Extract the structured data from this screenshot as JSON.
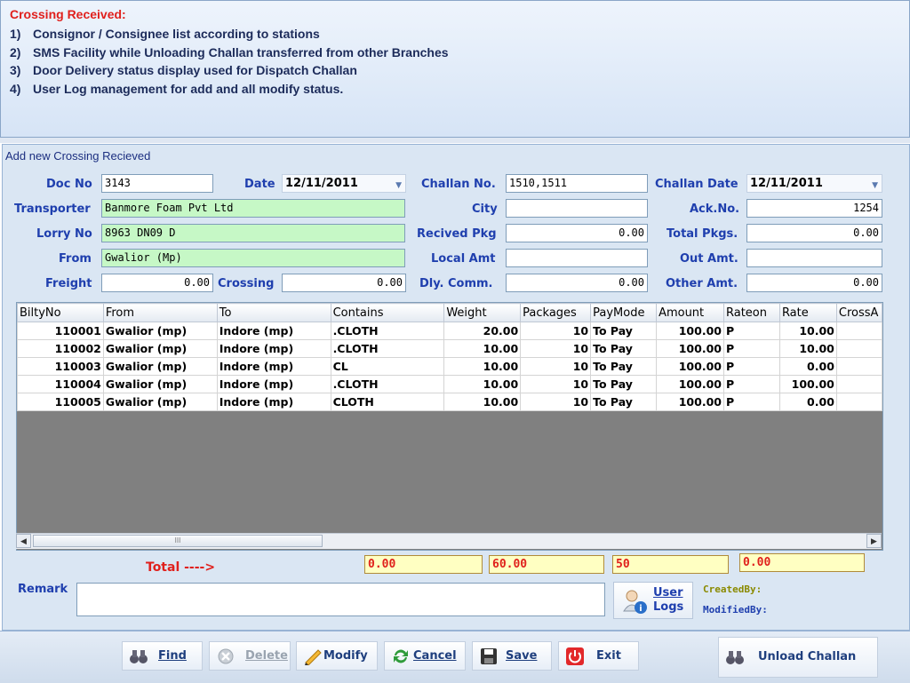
{
  "notes": {
    "title": "Crossing Received:",
    "items": [
      {
        "n": "1)",
        "text": "Consignor / Consignee list according to stations"
      },
      {
        "n": "2)",
        "text": "SMS Facility while Unloading Challan transferred from other Branches"
      },
      {
        "n": "3)",
        "text": "Door Delivery status display used for Dispatch Challan"
      },
      {
        "n": "4)",
        "text": "User Log management for add and all modify status."
      }
    ]
  },
  "form": {
    "title": "Add new Crossing Recieved",
    "labels": {
      "doc_no": "Doc No",
      "date": "Date",
      "challan_no": "Challan No.",
      "challan_date": "Challan Date",
      "transporter": "Transporter",
      "city": "City",
      "ack_no": "Ack.No.",
      "lorry_no": "Lorry No",
      "recived_pkg": "Recived Pkg",
      "total_pkgs": "Total Pkgs.",
      "from": "From",
      "local_amt": "Local Amt",
      "out_amt": "Out Amt.",
      "freight": "Freight",
      "crossing": "Crossing",
      "dly_comm": "Dly. Comm.",
      "other_amt": "Other Amt."
    },
    "values": {
      "doc_no": "3143",
      "date": "12/11/2011",
      "challan_no": "1510,1511",
      "challan_date": "12/11/2011",
      "transporter": "Banmore Foam Pvt Ltd",
      "city": "",
      "ack_no": "1254",
      "lorry_no": "8963 DN09 D",
      "recived_pkg": "0.00",
      "total_pkgs": "0.00",
      "from": "Gwalior (Mp)",
      "local_amt": "",
      "out_amt": "",
      "freight": "0.00",
      "crossing": "0.00",
      "dly_comm": "0.00",
      "other_amt": "0.00"
    }
  },
  "grid": {
    "columns": [
      "BiltyNo",
      "From",
      "To",
      "Contains",
      "Weight",
      "Packages",
      "PayMode",
      "Amount",
      "Rateon",
      "Rate",
      "CrossA"
    ],
    "rows": [
      [
        "110001",
        "Gwalior (mp)",
        "Indore (mp)",
        ".CLOTH",
        "20.00",
        "10",
        "To Pay",
        "100.00",
        "P",
        "10.00",
        ""
      ],
      [
        "110002",
        "Gwalior (mp)",
        "Indore (mp)",
        ".CLOTH",
        "10.00",
        "10",
        "To Pay",
        "100.00",
        "P",
        "10.00",
        ""
      ],
      [
        "110003",
        "Gwalior (mp)",
        "Indore (mp)",
        "CL",
        "10.00",
        "10",
        "To Pay",
        "100.00",
        "P",
        "0.00",
        ""
      ],
      [
        "110004",
        "Gwalior (mp)",
        "Indore (mp)",
        ".CLOTH",
        "10.00",
        "10",
        "To Pay",
        "100.00",
        "P",
        "100.00",
        ""
      ],
      [
        "110005",
        "Gwalior (mp)",
        "Indore (mp)",
        "CLOTH",
        "10.00",
        "10",
        "To Pay",
        "100.00",
        "P",
        "0.00",
        ""
      ]
    ],
    "scroll_thumb_mark": "III"
  },
  "totals": {
    "label": "Total ---->",
    "values": [
      "0.00",
      "60.00",
      "50",
      "0.00"
    ]
  },
  "remark": {
    "label": "Remark",
    "value": ""
  },
  "user_logs": {
    "line1": "User",
    "line2": "Logs"
  },
  "meta": {
    "created_by": "CreatedBy:",
    "modified_by": "ModifiedBy:",
    "created_color": "#8a8a00",
    "modified_color": "#1f3fae"
  },
  "toolbar": {
    "find": "Find",
    "delete": "Delete",
    "modify": "Modify",
    "cancel": "Cancel",
    "save": "Save",
    "exit": "Exit",
    "unload": "Unload Challan"
  },
  "colors": {
    "label_blue": "#1f3fae",
    "accent_red": "#e0201c",
    "green_field": "#c6f8c6",
    "total_field": "#ffffc2"
  }
}
